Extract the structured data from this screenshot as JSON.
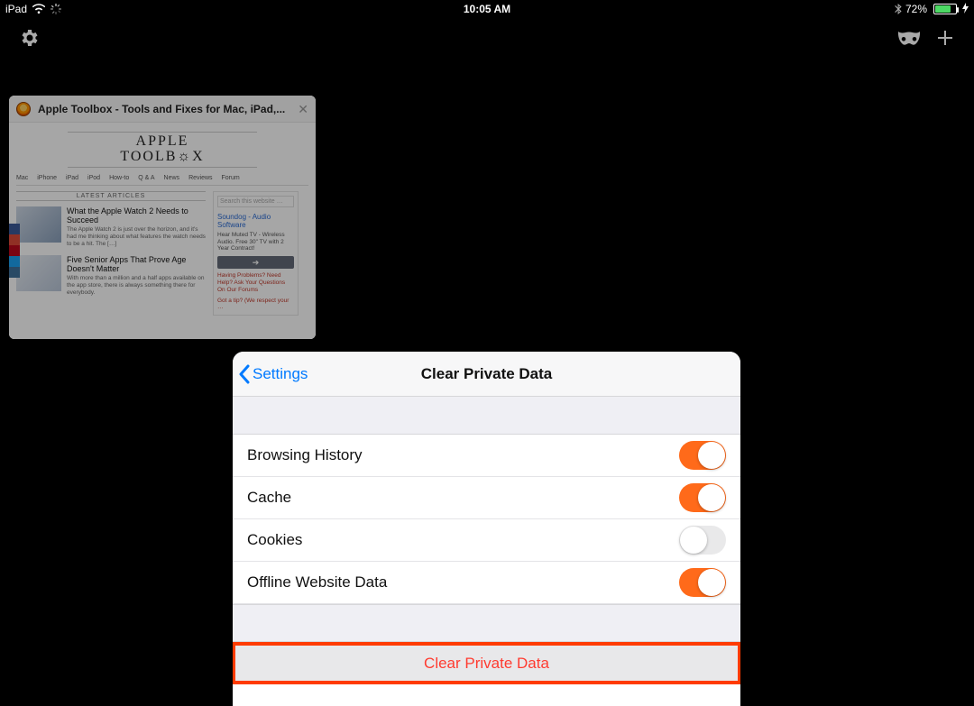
{
  "status": {
    "device": "iPad",
    "time": "10:05 AM",
    "battery_pct": "72%"
  },
  "tab": {
    "title": "Apple Toolbox - Tools and Fixes for Mac, iPad,...",
    "logo_line1": "APPLE",
    "logo_line2": "TOOLB☼X",
    "nav": [
      "Mac",
      "iPhone",
      "iPad",
      "iPod",
      "How-to",
      "Q & A",
      "News",
      "Reviews",
      "Forum"
    ],
    "latest_header": "LATEST ARTICLES",
    "articles": [
      {
        "title": "What the Apple Watch 2 Needs to Succeed",
        "body": "The Apple Watch 2 is just over the horizon, and it's had me thinking about what features the watch needs to be a hit. The […]"
      },
      {
        "title": "Five Senior Apps That Prove Age Doesn't Matter",
        "body": "With more than a million and a half apps available on the app store, there is always something there for everybody."
      }
    ],
    "sidebar": {
      "search_placeholder": "Search this website …",
      "ad_title": "Soundog - Audio Software",
      "ad_body": "Hear Muted TV - Wireless Audio. Free 30\" TV with 2 Year Contract!",
      "ad_arrow": "➔",
      "promo1": "Having Problems? Need Help? Ask Your Questions On Our Forums",
      "promo2": "Got a tip? (We respect your …"
    }
  },
  "modal": {
    "back_label": "Settings",
    "title": "Clear Private Data",
    "rows": [
      {
        "label": "Browsing History",
        "on": true
      },
      {
        "label": "Cache",
        "on": true
      },
      {
        "label": "Cookies",
        "on": false
      },
      {
        "label": "Offline Website Data",
        "on": true
      }
    ],
    "clear_button": "Clear Private Data"
  }
}
